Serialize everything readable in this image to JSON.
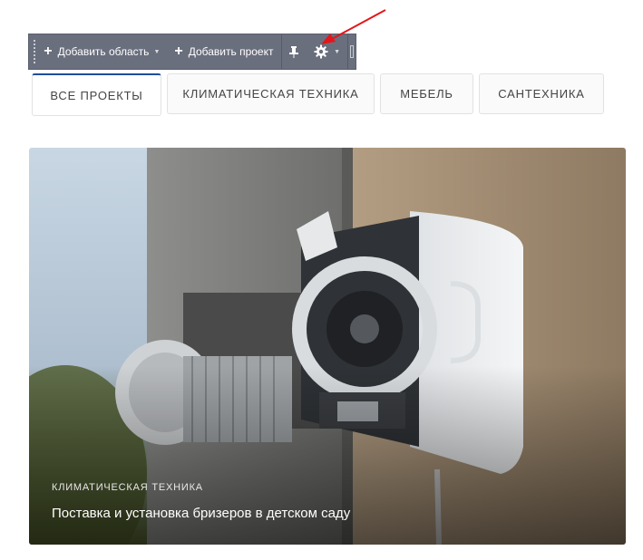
{
  "toolbar": {
    "add_area_label": "Добавить область",
    "add_project_label": "Добавить проект"
  },
  "tabs": [
    {
      "label": "ВСЕ ПРОЕКТЫ",
      "active": true
    },
    {
      "label": "КЛИМАТИЧЕСКАЯ ТЕХНИКА",
      "active": false
    },
    {
      "label": "МЕБЕЛЬ",
      "active": false
    },
    {
      "label": "САНТЕХНИКА",
      "active": false
    }
  ],
  "project": {
    "category": "КЛИМАТИЧЕСКАЯ ТЕХНИКА",
    "title": "Поставка и установка бризеров в детском саду"
  },
  "colors": {
    "toolbar_bg": "#6a6f7e",
    "active_tab_accent": "#1d4f9c",
    "annotation_arrow": "#e3161b"
  },
  "icons": [
    "plus-icon",
    "pin-icon",
    "gear-icon",
    "chevron-down-icon",
    "annotation-arrow"
  ]
}
